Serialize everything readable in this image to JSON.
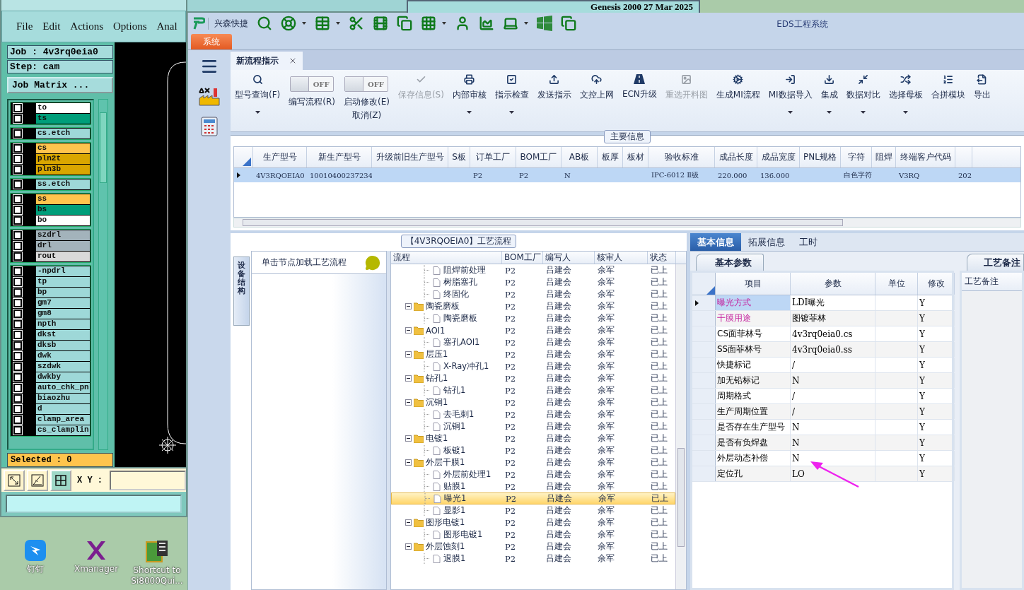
{
  "genesis": {
    "title": "Genesis 2000 27 Mar 2025",
    "menu": [
      "File",
      "Edit",
      "Actions",
      "Options",
      "Anal"
    ],
    "job": "Job : 4v3rq0eia0",
    "step": "Step: cam",
    "matrix_button": "Job Matrix ...",
    "layer_groups": [
      [
        {
          "name": "to",
          "color": "#ffffff",
          "checked": false
        },
        {
          "name": "ts",
          "color": "#009e7a",
          "checked": false
        }
      ],
      [
        {
          "name": "cs.etch",
          "color": "#9ed8d8",
          "checked": false
        }
      ],
      [
        {
          "name": "cs",
          "color": "#ffc44d",
          "checked": false
        },
        {
          "name": "pln2t",
          "color": "#d9a600",
          "checked": false
        },
        {
          "name": "pln3b",
          "color": "#d9a600",
          "checked": false
        }
      ],
      [
        {
          "name": "ss.etch",
          "color": "#9ed8d8",
          "checked": false
        }
      ],
      [
        {
          "name": "ss",
          "color": "#ffc44d",
          "checked": false
        },
        {
          "name": "bs",
          "color": "#009e7a",
          "checked": false
        },
        {
          "name": "bo",
          "color": "#ffffff",
          "checked": false
        }
      ],
      [
        {
          "name": "szdrl",
          "color": "#a3b3bb",
          "checked": false
        },
        {
          "name": "drl",
          "color": "#a3b3bb",
          "checked": false
        },
        {
          "name": "rout",
          "color": "#d9d9d9",
          "checked": false
        }
      ],
      [
        {
          "name": "-npdrl",
          "color": "#9ed8d8",
          "checked": false
        },
        {
          "name": "tp",
          "color": "#9ed8d8",
          "checked": false
        },
        {
          "name": "bp",
          "color": "#9ed8d8",
          "checked": false
        },
        {
          "name": "gm7",
          "color": "#9ed8d8",
          "checked": false
        },
        {
          "name": "gm8",
          "color": "#9ed8d8",
          "checked": false
        },
        {
          "name": "npth",
          "color": "#9ed8d8",
          "checked": false
        },
        {
          "name": "dkst",
          "color": "#9ed8d8",
          "checked": false
        },
        {
          "name": "dksb",
          "color": "#9ed8d8",
          "checked": false
        },
        {
          "name": "dwk",
          "color": "#9ed8d8",
          "checked": false
        },
        {
          "name": "szdwk",
          "color": "#9ed8d8",
          "checked": false
        },
        {
          "name": "dwkby",
          "color": "#9ed8d8",
          "checked": false
        },
        {
          "name": "auto_chk_pn",
          "color": "#9ed8d8",
          "checked": false
        },
        {
          "name": "biaozhu",
          "color": "#9ed8d8",
          "checked": false
        },
        {
          "name": "d",
          "color": "#9ed8d8",
          "checked": false
        },
        {
          "name": "clamp_area",
          "color": "#9ed8d8",
          "checked": false
        },
        {
          "name": "cs_clamplin",
          "color": "#9ed8d8",
          "checked": false
        }
      ]
    ],
    "selected_count": "Selected : 0",
    "xy_label": "X Y :"
  },
  "desktop_icons": [
    {
      "label": "钉钉"
    },
    {
      "label": "Xmanager"
    },
    {
      "label": "Shortcut to Si8000Qui..."
    }
  ],
  "app": {
    "brand": "兴森快捷",
    "title": "EDS工程系统",
    "system_tab": "系统",
    "doc_tabs": [
      {
        "label": "新流程指示",
        "selected": true
      }
    ],
    "ribbon": [
      {
        "kind": "button",
        "label": "型号查询(F)",
        "dropdown": true,
        "disabled": false
      },
      {
        "kind": "toggle",
        "state_label": "OFF",
        "on": false,
        "label": "编写流程(R)"
      },
      {
        "kind": "toggle",
        "state_label": "OFF",
        "on": false,
        "label": "启动修改(E)",
        "label2": "取消(Z)"
      },
      {
        "kind": "button",
        "label": "保存信息(S)",
        "dropdown": false,
        "disabled": true
      },
      {
        "kind": "button",
        "label": "内部审核",
        "dropdown": true,
        "disabled": false
      },
      {
        "kind": "button",
        "label": "指示检查",
        "dropdown": true,
        "disabled": false
      },
      {
        "kind": "button",
        "label": "发送指示",
        "dropdown": false,
        "disabled": false
      },
      {
        "kind": "button",
        "label": "文控上网",
        "dropdown": false,
        "disabled": false
      },
      {
        "kind": "button",
        "label": "ECN升级",
        "dropdown": false,
        "disabled": false
      },
      {
        "kind": "button",
        "label": "重选开料图",
        "dropdown": false,
        "disabled": true
      },
      {
        "kind": "button",
        "label": "生成MI流程",
        "dropdown": false,
        "disabled": false
      },
      {
        "kind": "button",
        "label": "MI数据导入",
        "dropdown": true,
        "disabled": false
      },
      {
        "kind": "button",
        "label": "集成",
        "dropdown": true,
        "disabled": false
      },
      {
        "kind": "button",
        "label": "数据对比",
        "dropdown": true,
        "disabled": false
      },
      {
        "kind": "button",
        "label": "选择母板",
        "dropdown": true,
        "disabled": false
      },
      {
        "kind": "button",
        "label": "合拼模块",
        "dropdown": false,
        "disabled": false
      },
      {
        "kind": "button",
        "label": "导出",
        "dropdown": false,
        "disabled": false
      }
    ],
    "main_info": {
      "title": "主要信息",
      "columns": [
        "生产型号",
        "新生产型号",
        "升级前旧生产型号",
        "S板",
        "订单工厂",
        "BOM工厂",
        "AB板",
        "板厚",
        "板材",
        "验收标准",
        "成品长度",
        "成品宽度",
        "PNL规格",
        "字符",
        "阻焊",
        "终端客户代码"
      ],
      "rows": [
        {
          "selected": true,
          "cells": [
            "4V3RQOEIA0",
            "10010400237234",
            null,
            null,
            "P2",
            "P2",
            "N",
            null,
            null,
            "IPC-6012 Ⅱ级",
            "220.000",
            "136.000",
            null,
            "白色字符",
            null,
            "V3RQ",
            "202"
          ]
        }
      ]
    },
    "process": {
      "title": "【4V3RQOEIA0】工艺流程",
      "side_tab": "设备结构",
      "hint": "单击节点加载工艺流程",
      "tree": {
        "columns": [
          "流程",
          "BOM工厂",
          "编写人",
          "核审人",
          "状态"
        ],
        "nodes": [
          {
            "children": [
              {
                "cells": [
                  "阻焊前处理",
                  "P2",
                  "吕建会",
                  "余军",
                  "已上"
                ],
                "selected": false
              },
              {
                "cells": [
                  "树脂塞孔",
                  "P2",
                  "吕建会",
                  "余军",
                  "已上"
                ],
                "selected": false
              },
              {
                "cells": [
                  "终固化",
                  "P2",
                  "吕建会",
                  "余军",
                  "已上"
                ],
                "selected": false
              }
            ]
          },
          {
            "cells": [
              "陶瓷磨板",
              "P2",
              "吕建会",
              "余军",
              "已上"
            ],
            "selected": false,
            "expanded": true,
            "children": [
              {
                "cells": [
                  "陶瓷磨板",
                  "P2",
                  "吕建会",
                  "余军",
                  "已上"
                ],
                "selected": false
              }
            ]
          },
          {
            "cells": [
              "AOI1",
              "P2",
              "吕建会",
              "余军",
              "已上"
            ],
            "selected": false,
            "expanded": true,
            "children": [
              {
                "cells": [
                  "塞孔AOI1",
                  "P2",
                  "吕建会",
                  "余军",
                  "已上"
                ],
                "selected": false
              }
            ]
          },
          {
            "cells": [
              "层压1",
              "P2",
              "吕建会",
              "余军",
              "已上"
            ],
            "selected": false,
            "expanded": true,
            "children": [
              {
                "cells": [
                  "X-Ray冲孔1",
                  "P2",
                  "吕建会",
                  "余军",
                  "已上"
                ],
                "selected": false
              }
            ]
          },
          {
            "cells": [
              "钻孔1",
              "P2",
              "吕建会",
              "余军",
              "已上"
            ],
            "selected": false,
            "expanded": true,
            "children": [
              {
                "cells": [
                  "钻孔1",
                  "P2",
                  "吕建会",
                  "余军",
                  "已上"
                ],
                "selected": false
              }
            ]
          },
          {
            "cells": [
              "沉铜1",
              "P2",
              "吕建会",
              "余军",
              "已上"
            ],
            "selected": false,
            "expanded": true,
            "children": [
              {
                "cells": [
                  "去毛刺1",
                  "P2",
                  "吕建会",
                  "余军",
                  "已上"
                ],
                "selected": false
              },
              {
                "cells": [
                  "沉铜1",
                  "P2",
                  "吕建会",
                  "余军",
                  "已上"
                ],
                "selected": false
              }
            ]
          },
          {
            "cells": [
              "电镀1",
              "P2",
              "吕建会",
              "余军",
              "已上"
            ],
            "selected": false,
            "expanded": true,
            "children": [
              {
                "cells": [
                  "板镀1",
                  "P2",
                  "吕建会",
                  "余军",
                  "已上"
                ],
                "selected": false
              }
            ]
          },
          {
            "cells": [
              "外层干膜1",
              "P2",
              "吕建会",
              "余军",
              "已上"
            ],
            "selected": false,
            "expanded": true,
            "children": [
              {
                "cells": [
                  "外层前处理1",
                  "P2",
                  "吕建会",
                  "余军",
                  "已上"
                ],
                "selected": false
              },
              {
                "cells": [
                  "贴膜1",
                  "P2",
                  "吕建会",
                  "余军",
                  "已上"
                ],
                "selected": false
              },
              {
                "cells": [
                  "曝光1",
                  "P2",
                  "吕建会",
                  "余军",
                  "已上"
                ],
                "selected": true
              },
              {
                "cells": [
                  "显影1",
                  "P2",
                  "吕建会",
                  "余军",
                  "已上"
                ],
                "selected": false
              }
            ]
          },
          {
            "cells": [
              "图形电镀1",
              "P2",
              "吕建会",
              "余军",
              "已上"
            ],
            "selected": false,
            "expanded": true,
            "children": [
              {
                "cells": [
                  "图形电镀1",
                  "P2",
                  "吕建会",
                  "余军",
                  "已上"
                ],
                "selected": false
              }
            ]
          },
          {
            "cells": [
              "外层蚀刻1",
              "P2",
              "吕建会",
              "余军",
              "已上"
            ],
            "selected": false,
            "expanded": true,
            "children": [
              {
                "cells": [
                  "退膜1",
                  "P2",
                  "吕建会",
                  "余军",
                  "已上"
                ],
                "selected": false
              }
            ]
          }
        ]
      }
    },
    "details": {
      "tabs": [
        {
          "label": "基本信息",
          "selected": true
        },
        {
          "label": "拓展信息",
          "selected": false
        },
        {
          "label": "工时",
          "selected": false
        }
      ],
      "subtab": "基本参数",
      "columns": [
        "项目",
        "参数",
        "单位",
        "修改"
      ],
      "rows": [
        {
          "item": "曝光方式",
          "value": "LDI曝光",
          "modify": "Y",
          "highlighted": true,
          "selected": true
        },
        {
          "item": "干膜用途",
          "value": "图镀菲林",
          "modify": "Y",
          "highlighted": true,
          "selected": false
        },
        {
          "item": "CS面菲林号",
          "value": "4v3rq0eia0.cs",
          "modify": "Y",
          "highlighted": false,
          "selected": false
        },
        {
          "item": "SS面菲林号",
          "value": "4v3rq0eia0.ss",
          "modify": "Y",
          "highlighted": false,
          "selected": false
        },
        {
          "item": "快捷标记",
          "value": "/",
          "modify": "Y",
          "highlighted": false,
          "selected": false
        },
        {
          "item": "加无铅标记",
          "value": "N",
          "modify": "Y",
          "highlighted": false,
          "selected": false
        },
        {
          "item": "周期格式",
          "value": "/",
          "modify": "Y",
          "highlighted": false,
          "selected": false
        },
        {
          "item": "生产周期位置",
          "value": "/",
          "modify": "Y",
          "highlighted": false,
          "selected": false
        },
        {
          "item": "是否存在生产型号",
          "value": "N",
          "modify": "Y",
          "highlighted": false,
          "selected": false
        },
        {
          "item": "是否有负焊盘",
          "value": "N",
          "modify": "Y",
          "highlighted": false,
          "selected": false
        },
        {
          "item": "外层动态补偿",
          "value": "N",
          "modify": "Y",
          "highlighted": false,
          "selected": false
        },
        {
          "item": "定位孔",
          "value": "LO",
          "modify": "Y",
          "highlighted": false,
          "selected": false
        }
      ],
      "notes_tab": "工艺备注",
      "notes_header": "工艺备注"
    }
  }
}
